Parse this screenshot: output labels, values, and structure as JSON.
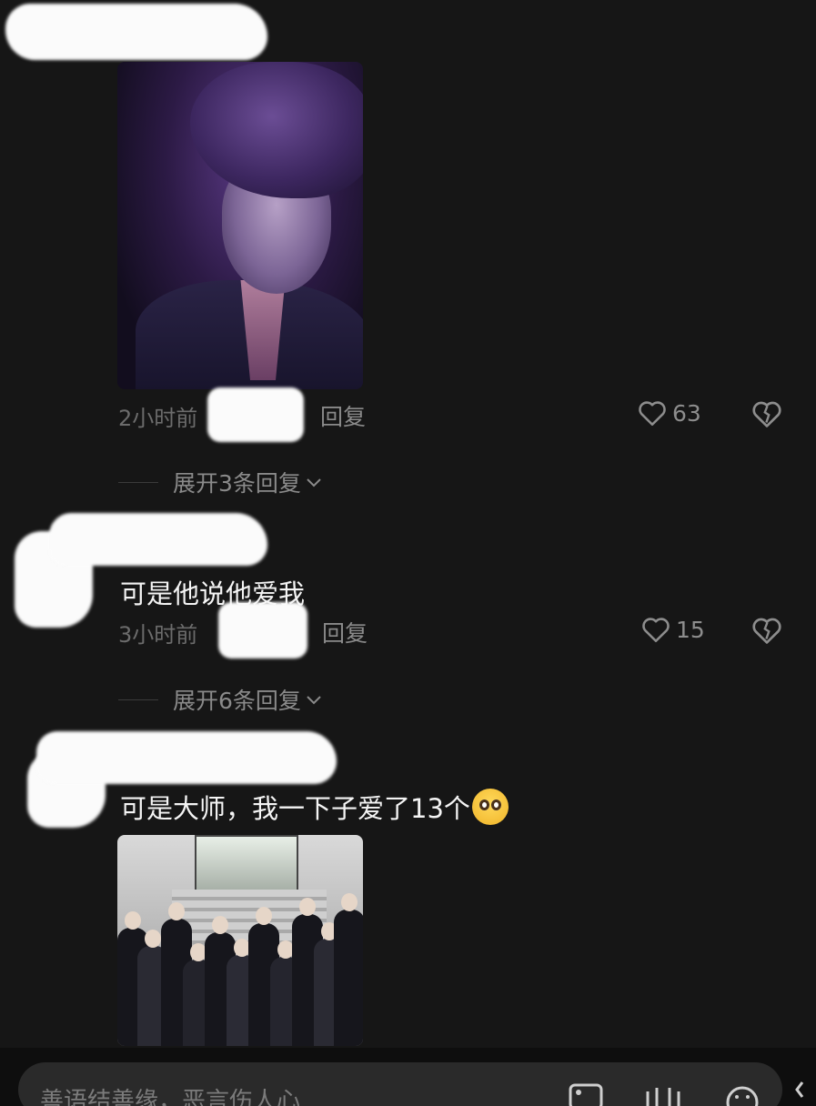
{
  "comments": [
    {
      "time": "2小时前",
      "reply_label": "回复",
      "likes": "63",
      "expand_label": "展开3条回复"
    },
    {
      "text": "可是他说他爱我",
      "time": "3小时前",
      "reply_label": "回复",
      "likes": "15",
      "expand_label": "展开6条回复"
    },
    {
      "text": "可是大师，我一下子爱了13个"
    }
  ],
  "composer": {
    "placeholder": "善语结善缘，恶言伤人心"
  },
  "icons": [
    "heart-icon",
    "broken-heart-icon",
    "chevron-down-icon",
    "image-icon",
    "emoji-icon"
  ]
}
